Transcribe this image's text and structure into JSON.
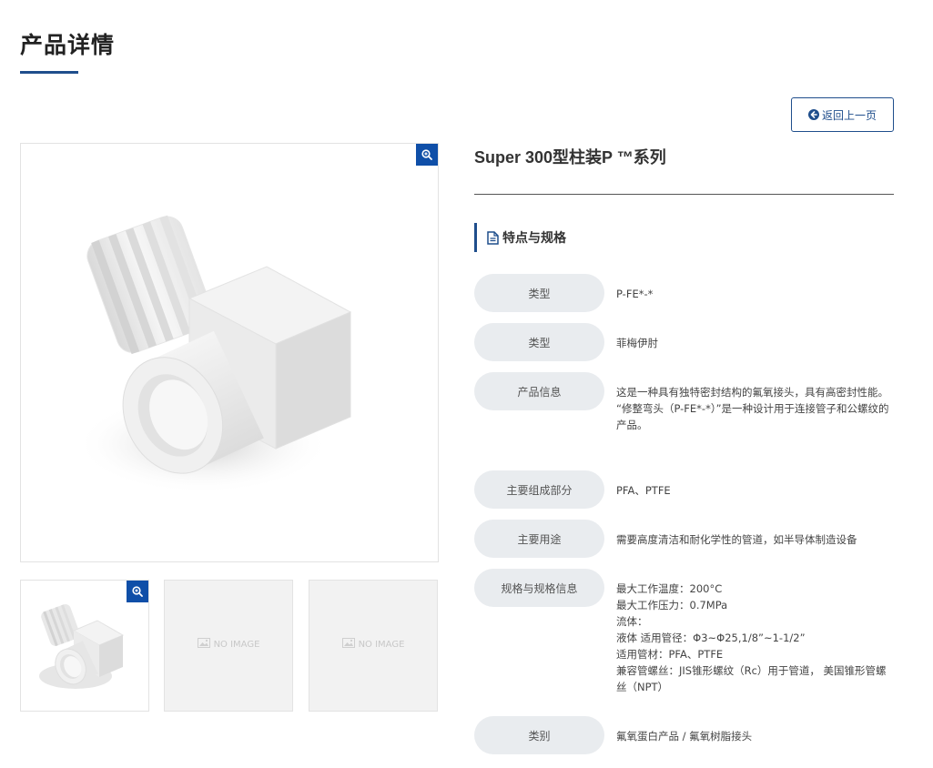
{
  "page": {
    "title": "产品详情"
  },
  "back_button": {
    "label": "返回上一页",
    "icon": "arrow-circle-left-icon"
  },
  "gallery": {
    "zoom_icon": "zoom-in-icon",
    "thumbnails": [
      {
        "type": "image"
      },
      {
        "type": "placeholder",
        "label": "NO IMAGE"
      },
      {
        "type": "placeholder",
        "label": "NO IMAGE"
      }
    ]
  },
  "product": {
    "name": "Super 300型柱装P ™系列"
  },
  "section": {
    "title": "特点与规格",
    "icon": "document-icon"
  },
  "specs": [
    {
      "label": "类型",
      "value": "P-FE*-*"
    },
    {
      "label": "类型",
      "value": "菲梅伊肘"
    },
    {
      "label": "产品信息",
      "value": "这是一种具有独特密封结构的氟氧接头，具有高密封性能。\n“修整弯头（P-FE*-*）”是一种设计用于连接管子和公螺纹的产品。"
    },
    {
      "label": "主要组成部分",
      "value": "PFA、PTFE"
    },
    {
      "label": "主要用途",
      "value": "需要高度清洁和耐化学性的管道，如半导体制造设备"
    },
    {
      "label": "规格与规格信息",
      "value": "最大工作温度：200°C\n最大工作压力：0.7MPa\n流体：\n液体 适用管径：Φ3~Φ25,1/8”~1-1/2”\n适用管材：PFA、PTFE\n兼容管螺丝：JIS锥形螺纹（Rc）用于管道， 美国锥形管螺丝（NPT）"
    },
    {
      "label": "类别",
      "value": "氟氧蛋白产品 / 氟氧树脂接头"
    }
  ],
  "colors": {
    "accent": "#1f4e8c",
    "zoom_button": "#0f4fa8",
    "pill_bg": "#e9ecef"
  }
}
